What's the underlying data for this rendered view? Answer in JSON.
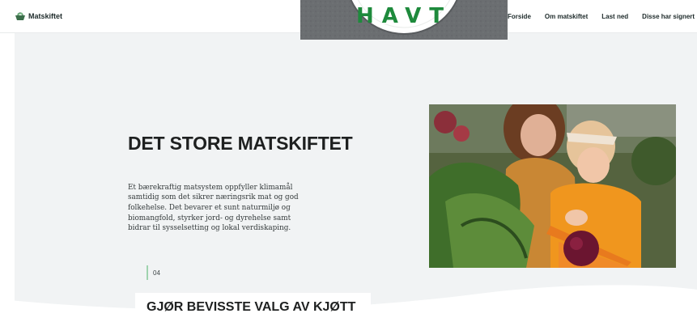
{
  "header": {
    "brand": "Matskiftet",
    "nav": [
      "Forside",
      "Om matskiftet",
      "Last ned",
      "Disse har signert"
    ]
  },
  "badge": {
    "text": "HAVT"
  },
  "hero": {
    "title": "DET STORE MATSKIFTET",
    "body": "Et bærekraftig matsystem oppfyller klimamål samtidig som det sikrer næringsrik mat og god folkehelse. Det bevarer et sunt naturmiljø og biomangfold, styrker jord- og dyrehelse samt bidrar til sysselsetting og lokal verdiskaping.",
    "photo": "mother-and-child-with-vegetables"
  },
  "section": {
    "number": "04",
    "title": "GJØR BEVISSTE VALG AV KJØTT"
  },
  "colors": {
    "text": "#1e2020",
    "background": "#f1f3f4",
    "accent": "#9fd3ae",
    "badge_green": "#1e8a3c"
  }
}
